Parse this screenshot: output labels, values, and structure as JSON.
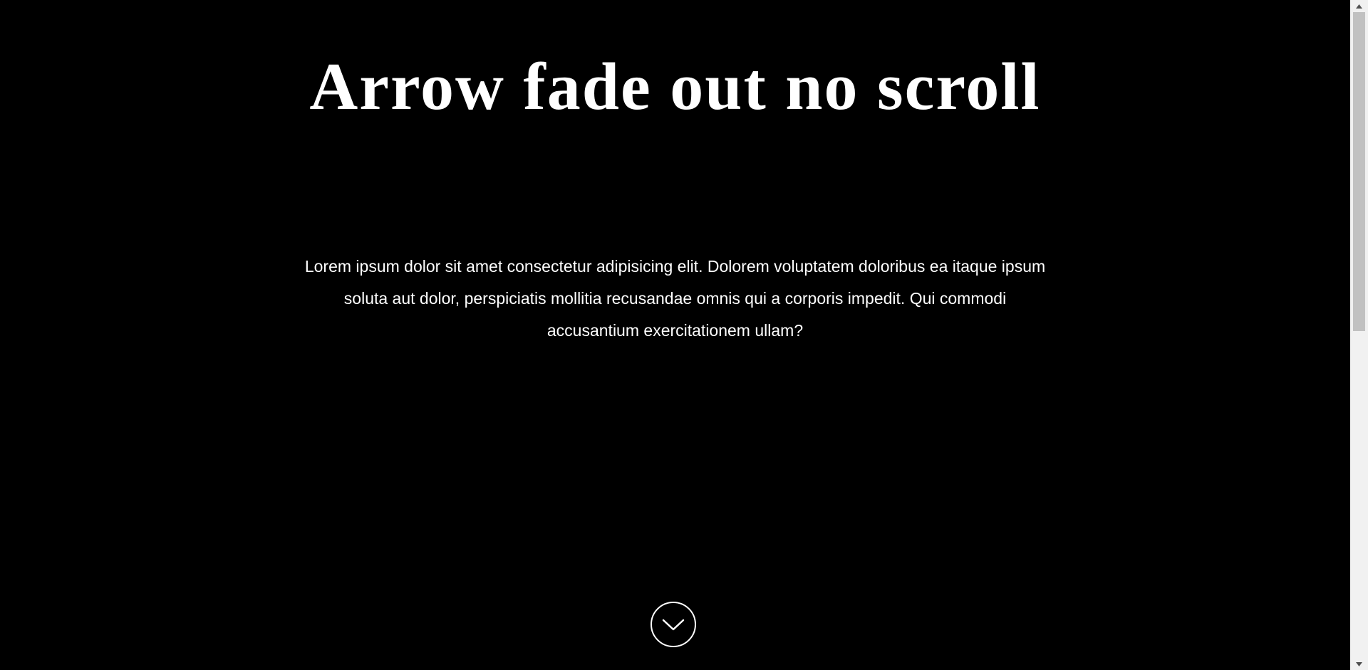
{
  "page": {
    "title": "Arrow fade out no scroll",
    "body_text": "Lorem ipsum dolor sit amet consectetur adipisicing elit. Dolorem voluptatem doloribus ea itaque ipsum soluta aut dolor, perspiciatis mollitia recusandae omnis qui a corporis impedit. Qui commodi accusantium exercitationem ullam?"
  },
  "scroll_arrow": {
    "icon": "chevron-down-icon"
  },
  "colors": {
    "background": "#000000",
    "text": "#ffffff",
    "scrollbar_track": "#f1f1f1",
    "scrollbar_thumb": "#c1c1c1"
  }
}
